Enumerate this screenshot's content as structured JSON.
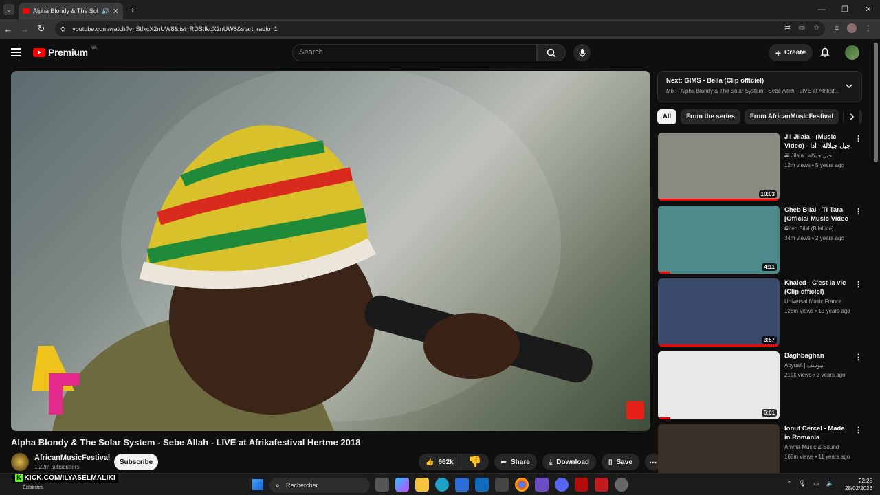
{
  "browser": {
    "tab_title": "Alpha Blondy & The Solar S",
    "url": "youtube.com/watch?v=StfkcX2nUW8&list=RDStfkcX2nUW8&start_radio=1"
  },
  "header": {
    "logo_text": "Premium",
    "country_code": "MA",
    "search_placeholder": "Search",
    "create_label": "Create"
  },
  "video": {
    "title": "Alpha Blondy & The Solar System - Sebe Allah - LIVE at Afrikafestival Hertme 2018",
    "channel": "AfricanMusicFestival",
    "subscribers": "1.22m subscribers",
    "subscribe_label": "Subscribe",
    "likes": "662k",
    "share_label": "Share",
    "download_label": "Download",
    "save_label": "Save"
  },
  "next_card": {
    "label": "Next:",
    "title": "GIMS - Bella (Clip officiel)",
    "mix": "Mix – Alpha Blondy & The Solar System - Sebe Allah - LIVE at Afrikaf..."
  },
  "chips": [
    "All",
    "From the series",
    "From AfricanMusicFestival"
  ],
  "recommendations": [
    {
      "title": "Jil Jilala - (Music Video) - جيل جيلالة - اذا ...",
      "channel": "Jil Jilala | جيل جيلالة",
      "meta": "12m views • 5 years ago",
      "duration": "10:03",
      "progress": 1.0,
      "color": "#8a8a80"
    },
    {
      "title": "Cheb Bilal - Ti Tara [Official Music Video ...",
      "channel": "Cheb Bilal (Bilaliste)",
      "meta": "34m views • 2 years ago",
      "duration": "4:11",
      "progress": 0.1,
      "color": "#4d8a8c"
    },
    {
      "title": "Khaled - C'est la vie (Clip officiel)",
      "channel": "Universal Music France",
      "meta": "128m views • 13 years ago",
      "duration": "3:57",
      "progress": 1.0,
      "color": "#3a4a6a"
    },
    {
      "title": "Baghbaghan",
      "channel": "Abyusif | أبيوسف",
      "meta": "219k views • 2 years ago",
      "duration": "5:01",
      "progress": 0.1,
      "color": "#e8e8e8"
    },
    {
      "title": "Ionut Cercel - Made in Romania",
      "channel": "Amma Music & Sound",
      "meta": "165m views • 11 years ago",
      "duration": "",
      "progress": 0,
      "color": "#3b3028"
    }
  ],
  "taskbar": {
    "overlay_text": "KICK.COM/ILYASELMALIKI",
    "weather": "Éclaircies",
    "search_label": "Rechercher",
    "time": "22:25",
    "date": "28/02/2026"
  }
}
